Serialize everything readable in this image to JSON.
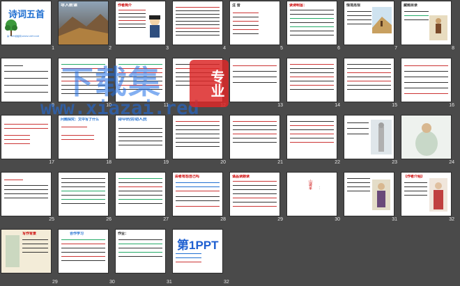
{
  "watermark": {
    "title": "下载集",
    "url": "www.xiazai.red",
    "badge": "专业"
  },
  "slides": [
    {
      "n": "1",
      "title": "诗词五首",
      "footer": "第一PPT模板网-WWW.1PPT.COM"
    },
    {
      "n": "2",
      "title": "导入新课"
    },
    {
      "n": "3",
      "title": "作者简介"
    },
    {
      "n": "4",
      "title": "注 音"
    },
    {
      "n": "5",
      "title": "读诗明旨："
    },
    {
      "n": "6",
      "title": "情境再现"
    },
    {
      "n": "7",
      "title": "藏题目录"
    },
    {
      "n": "8",
      "title": ""
    },
    {
      "n": "9",
      "title": ""
    },
    {
      "n": "10",
      "title": ""
    },
    {
      "n": "11",
      "title": ""
    },
    {
      "n": "12",
      "title": ""
    },
    {
      "n": "13",
      "title": ""
    },
    {
      "n": "14",
      "title": ""
    },
    {
      "n": "15",
      "title": ""
    },
    {
      "n": "16",
      "title": "问题探究：文中写了什么"
    },
    {
      "n": "17",
      "title": "诗中的劳动人民"
    },
    {
      "n": "18",
      "title": ""
    },
    {
      "n": "19",
      "title": ""
    },
    {
      "n": "20",
      "title": ""
    },
    {
      "n": "21",
      "title": ""
    },
    {
      "n": "22",
      "title": ""
    },
    {
      "n": "23",
      "title": ""
    },
    {
      "n": "24",
      "title": ""
    },
    {
      "n": "25",
      "title": "由者有怨自己吗"
    },
    {
      "n": "26",
      "title": "请品读朗读"
    },
    {
      "n": "27",
      "title": "山坡羊"
    },
    {
      "n": "28",
      "title": "【作者介绍】"
    },
    {
      "n": "29",
      "title": "写作背景"
    },
    {
      "n": "30",
      "title": "合作学习"
    },
    {
      "n": "31",
      "title": "作业："
    },
    {
      "n": "32",
      "title": "第1PPT"
    }
  ]
}
